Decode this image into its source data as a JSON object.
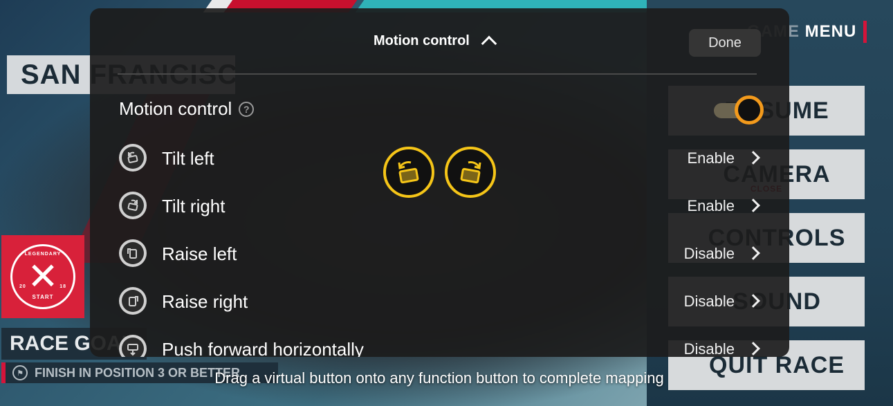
{
  "game": {
    "city": "SAN FRANCISCO",
    "menu_title_prefix": "GAME",
    "menu_title": "MENU",
    "menu_buttons": [
      {
        "label": "RESUME"
      },
      {
        "label": "CAMERA",
        "sub": "CLOSE"
      },
      {
        "label": "CONTROLS"
      },
      {
        "label": "SOUND"
      },
      {
        "label": "QUIT RACE"
      }
    ],
    "badge": {
      "top": "LEGENDARY",
      "bottom": "START",
      "left": "20",
      "right": "18"
    },
    "race_goal": "RACE GOAL",
    "goal_text": "FINISH IN POSITION 3 OR BETTER"
  },
  "dialog": {
    "title": "Motion control",
    "done_label": "Done",
    "motion_control_label": "Motion control",
    "motion_control_on": true,
    "functions": [
      {
        "label": "Tilt left",
        "status": "Enable"
      },
      {
        "label": "Tilt right",
        "status": "Enable"
      },
      {
        "label": "Raise left",
        "status": "Disable"
      },
      {
        "label": "Raise right",
        "status": "Disable"
      },
      {
        "label": "Push forward horizontally",
        "status": "Disable"
      }
    ],
    "virtual_buttons": [
      "tilt-left-virtual",
      "tilt-right-virtual"
    ]
  },
  "hint": "Drag a virtual button onto any function button to complete mapping",
  "colors": {
    "accent_orange": "#f39a1c",
    "virtual_yellow": "#f5c518",
    "brand_red": "#d4143a"
  }
}
